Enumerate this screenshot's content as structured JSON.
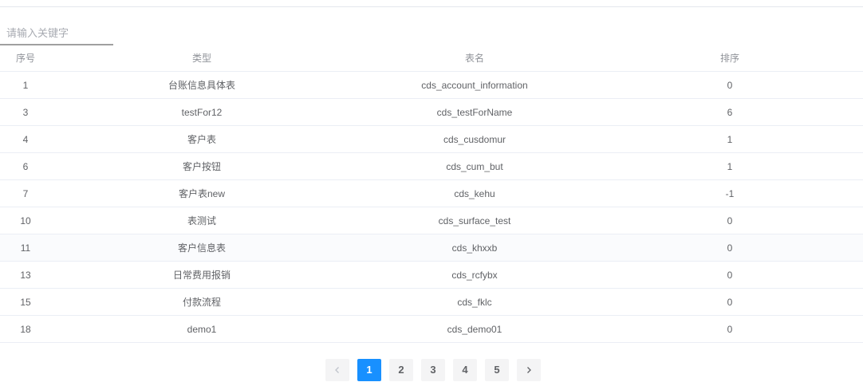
{
  "search": {
    "placeholder": "请输入关键字",
    "value": ""
  },
  "table": {
    "headers": [
      "序号",
      "类型",
      "表名",
      "排序"
    ],
    "rows": [
      [
        "1",
        "台账信息具体表",
        "cds_account_information",
        "0"
      ],
      [
        "3",
        "testFor12",
        "cds_testForName",
        "6"
      ],
      [
        "4",
        "客户表",
        "cds_cusdomur",
        "1"
      ],
      [
        "6",
        "客户按钮",
        "cds_cum_but",
        "1"
      ],
      [
        "7",
        "客户表new",
        "cds_kehu",
        "-1"
      ],
      [
        "10",
        "表测试",
        "cds_surface_test",
        "0"
      ],
      [
        "11",
        "客户信息表",
        "cds_khxxb",
        "0"
      ],
      [
        "13",
        "日常费用报销",
        "cds_rcfybx",
        "0"
      ],
      [
        "15",
        "付款流程",
        "cds_fklc",
        "0"
      ],
      [
        "18",
        "demo1",
        "cds_demo01",
        "0"
      ]
    ]
  },
  "pagination": {
    "pages": [
      "1",
      "2",
      "3",
      "4",
      "5"
    ],
    "current": "1",
    "prev_icon": "chevron-left-icon",
    "next_icon": "chevron-right-icon"
  },
  "colors": {
    "accent": "#1890ff",
    "row_border": "#ebeef5",
    "header_text": "#909399",
    "cell_text": "#606266"
  }
}
